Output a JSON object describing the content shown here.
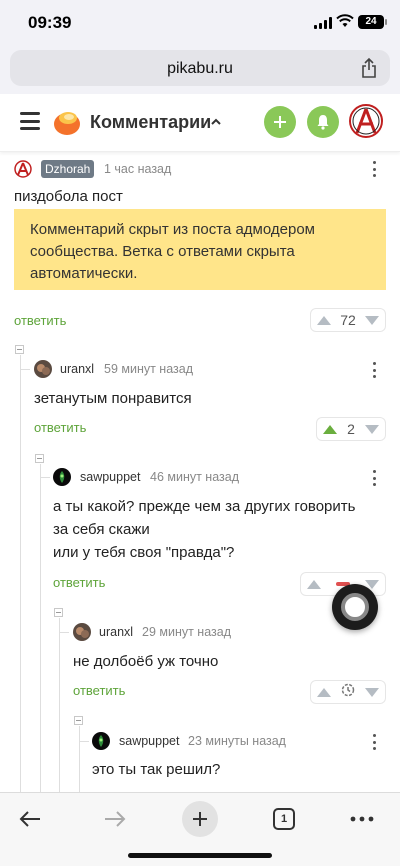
{
  "status_bar": {
    "time": "09:39",
    "battery": "24"
  },
  "browser": {
    "url": "pikabu.ru",
    "tabs_count": "1"
  },
  "header": {
    "title": "Комментарии"
  },
  "comments": [
    {
      "author": "Dzhorah",
      "time": "1 час назад",
      "text": "пиздобола пост",
      "hidden_note": "Комментарий скрыт из поста адмодером сообщества. Ветка с ответами скрыта автоматически.",
      "reply": "ответить",
      "rating": "72"
    },
    {
      "author": "uranxl",
      "time": "59 минут назад",
      "text": "зетанутым понравится",
      "reply": "ответить",
      "rating": "2"
    },
    {
      "author": "sawpuppet",
      "time": "46 минут назад",
      "text_line1": "а ты какой? прежде чем за других говорить",
      "text_line2": "за себя скажи",
      "text_line3": "или у тебя своя \"правда\"?",
      "reply": "ответить"
    },
    {
      "author": "uranxl",
      "time": "29 минут назад",
      "text": "не долбоёб уж точно",
      "reply": "ответить"
    },
    {
      "author": "sawpuppet",
      "time": "23 минуты назад",
      "text": "это ты так решил?"
    }
  ],
  "colors": {
    "accent_green": "#8ac858",
    "reply_green": "#5ea43a",
    "note_yellow": "#ffe58a",
    "badge_gray": "#6e7a86"
  }
}
